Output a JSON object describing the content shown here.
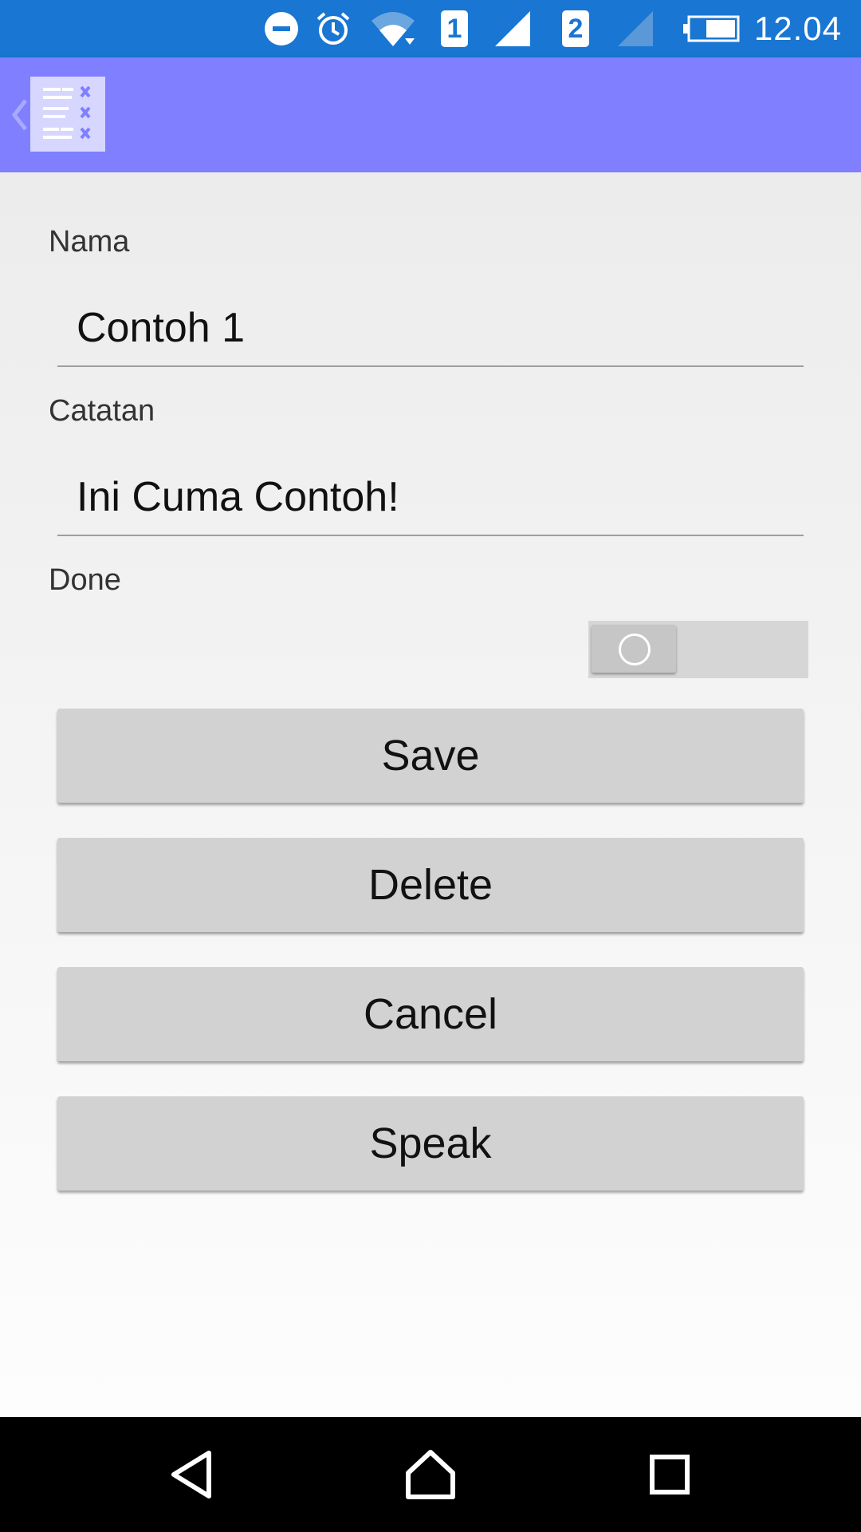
{
  "status_bar": {
    "time": "12.04",
    "sim1": "1",
    "sim2": "2",
    "icons": [
      "do-not-disturb-icon",
      "alarm-icon",
      "wifi-icon",
      "sim-1-icon",
      "signal-icon",
      "sim-2-icon",
      "signal-icon",
      "battery-icon"
    ]
  },
  "app_bar": {
    "icons": [
      "back-chevron-icon",
      "app-logo-icon"
    ],
    "accent": "#7f7fff"
  },
  "form": {
    "nama_label": "Nama",
    "nama_value": "Contoh 1",
    "catatan_label": "Catatan",
    "catatan_value": "Ini Cuma Contoh!",
    "done_label": "Done",
    "done_on": false
  },
  "buttons": {
    "save": "Save",
    "delete": "Delete",
    "cancel": "Cancel",
    "speak": "Speak"
  },
  "nav_bar": {
    "icons": [
      "back-triangle-icon",
      "home-icon",
      "recents-icon"
    ]
  }
}
